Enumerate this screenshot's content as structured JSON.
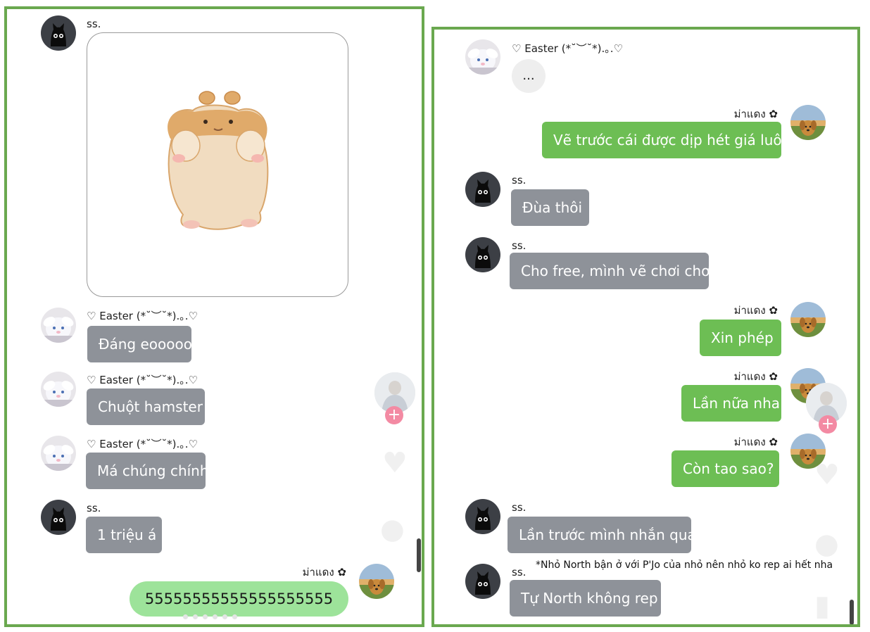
{
  "left_chat": {
    "messages": [
      {
        "sender": "ss.",
        "type": "sticker",
        "sticker": "hamster-sticker"
      },
      {
        "sender": "♡ Easter (*˘︶˘*).｡.♡",
        "text": "Đáng eooooo"
      },
      {
        "sender": "♡ Easter (*˘︶˘*).｡.♡",
        "text": "Chuột hamster"
      },
      {
        "sender": "♡ Easter (*˘︶˘*).｡.♡",
        "text": "Má chúng chính"
      },
      {
        "sender": "ss.",
        "text": "1 triệu á"
      },
      {
        "sender": "ม่าแดง ✿",
        "text": "55555555555555555555"
      }
    ],
    "floating_button": "plus-icon",
    "plus_symbol": "+"
  },
  "right_chat": {
    "messages": [
      {
        "sender": "♡ Easter (*˘︶˘*).｡.♡",
        "text": "..."
      },
      {
        "sender": "ม่าแดง ✿",
        "text": "Vẽ trước cái được dịp hét giá luôn"
      },
      {
        "sender": "ss.",
        "text": "Đùa thôi"
      },
      {
        "sender": "ss.",
        "text": "Cho free, mình vẽ chơi chơi"
      },
      {
        "sender": "ม่าแดง ✿",
        "text": "Xin phép"
      },
      {
        "sender": "ม่าแดง ✿",
        "text": "Lần nữa nha"
      },
      {
        "sender": "ม่าแดง ✿",
        "text": "Còn tao sao?"
      },
      {
        "sender": "ss.",
        "text": "Lần trước mình nhắn qua"
      },
      {
        "sender": "ss.",
        "text": "Tự North không rep"
      }
    ],
    "note": "*Nhỏ North bận ở với P'Jo của nhỏ nên nhỏ ko rep ai hết nha",
    "plus_symbol": "+"
  },
  "colors": {
    "frame": "#6aa84f",
    "gray_bubble": "#8e9299",
    "green_bubble": "#6dbe54",
    "light_green_bubble": "#9de39a",
    "plus_button": "#f38aa3"
  }
}
